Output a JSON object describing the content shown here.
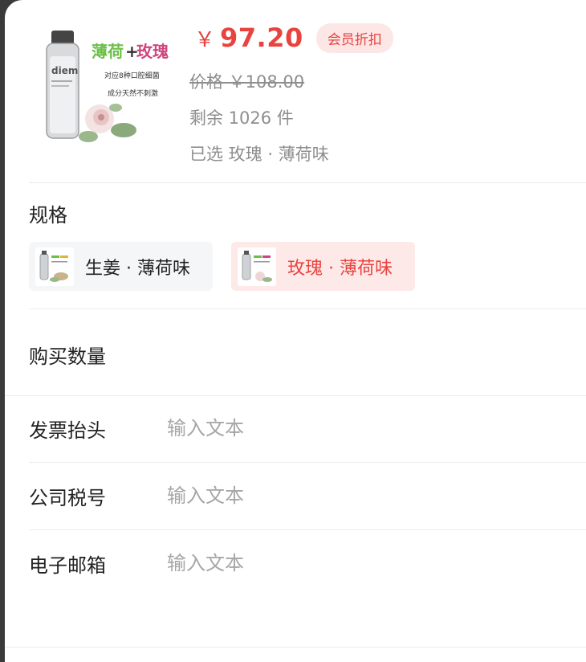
{
  "goods": {
    "image_caption": {
      "brand": "diem",
      "headline_part1": "薄荷",
      "headline_plus": "+",
      "headline_part2": "玫瑰",
      "line1": "对应8种口腔细菌",
      "line2": "成分天然不刺激"
    },
    "price_symbol": "￥",
    "price": "97.20",
    "vip_tag": "会员折扣",
    "origin_price": "价格 ￥108.00",
    "stock": "剩余 1026 件",
    "selected": "已选 玫瑰 · 薄荷味"
  },
  "spec": {
    "title": "规格",
    "options": [
      {
        "label": "生姜 · 薄荷味",
        "active": false
      },
      {
        "label": "玫瑰 · 薄荷味",
        "active": true
      }
    ]
  },
  "quantity": {
    "title": "购买数量"
  },
  "fields": [
    {
      "label": "发票抬头",
      "placeholder": "输入文本"
    },
    {
      "label": "公司税号",
      "placeholder": "输入文本"
    },
    {
      "label": "电子邮箱",
      "placeholder": "输入文本"
    }
  ],
  "colors": {
    "accent": "#e8433e",
    "accent_bg": "#fde6e6",
    "muted": "#8e8e8e",
    "divider": "#ececec"
  }
}
